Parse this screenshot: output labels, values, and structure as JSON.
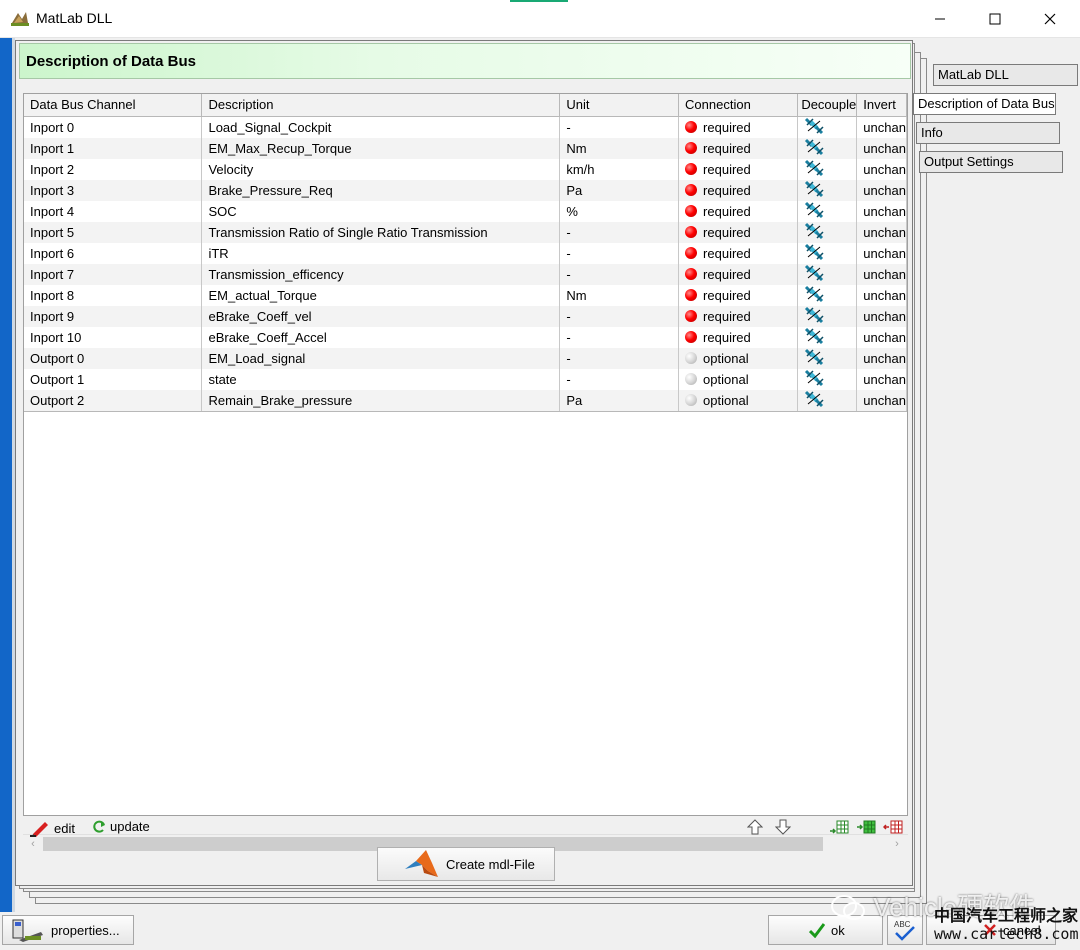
{
  "window": {
    "title": "MatLab DLL"
  },
  "header": {
    "title": "Description of Data Bus"
  },
  "table": {
    "columns": [
      "Data Bus Channel",
      "Description",
      "Unit",
      "Connection",
      "Decouple",
      "Invert"
    ],
    "rows": [
      {
        "channel": "Inport 0",
        "description": "Load_Signal_Cockpit",
        "unit": "-",
        "connection": "required",
        "invert": "unchan"
      },
      {
        "channel": "Inport 1",
        "description": "EM_Max_Recup_Torque",
        "unit": "Nm",
        "connection": "required",
        "invert": "unchan"
      },
      {
        "channel": "Inport 2",
        "description": "Velocity",
        "unit": "km/h",
        "connection": "required",
        "invert": "unchan"
      },
      {
        "channel": "Inport 3",
        "description": "Brake_Pressure_Req",
        "unit": "Pa",
        "connection": "required",
        "invert": "unchan"
      },
      {
        "channel": "Inport 4",
        "description": "SOC",
        "unit": "%",
        "connection": "required",
        "invert": "unchan"
      },
      {
        "channel": "Inport 5",
        "description": "Transmission Ratio of Single Ratio Transmission",
        "unit": "-",
        "connection": "required",
        "invert": "unchan"
      },
      {
        "channel": "Inport 6",
        "description": "iTR",
        "unit": "-",
        "connection": "required",
        "invert": "unchan"
      },
      {
        "channel": "Inport 7",
        "description": "Transmission_efficency",
        "unit": "-",
        "connection": "required",
        "invert": "unchan"
      },
      {
        "channel": "Inport 8",
        "description": "EM_actual_Torque",
        "unit": "Nm",
        "connection": "required",
        "invert": "unchan"
      },
      {
        "channel": "Inport 9",
        "description": "eBrake_Coeff_vel",
        "unit": "-",
        "connection": "required",
        "invert": "unchan"
      },
      {
        "channel": "Inport 10",
        "description": "eBrake_Coeff_Accel",
        "unit": "-",
        "connection": "required",
        "invert": "unchan"
      },
      {
        "channel": "Outport 0",
        "description": "EM_Load_signal",
        "unit": "-",
        "connection": "optional",
        "invert": "unchan"
      },
      {
        "channel": "Outport 1",
        "description": "state",
        "unit": "-",
        "connection": "optional",
        "invert": "unchan"
      },
      {
        "channel": "Outport 2",
        "description": "Remain_Brake_pressure",
        "unit": "Pa",
        "connection": "optional",
        "invert": "unchan"
      }
    ]
  },
  "toolbar": {
    "edit_label": "edit",
    "update_label": "update",
    "create_label": "Create mdl-File"
  },
  "tabs": [
    {
      "label": "MatLab DLL",
      "active": false
    },
    {
      "label": "Description of Data Bus",
      "active": true
    },
    {
      "label": "Info",
      "active": false
    },
    {
      "label": "Output Settings",
      "active": false
    }
  ],
  "bottom": {
    "properties_label": "properties...",
    "ok_label": "ok",
    "cancel_label": "cancel"
  },
  "watermark": {
    "line1": "Vehicle硬软件",
    "line2": "中国汽车工程师之家",
    "line3": "www.cartech8.com"
  },
  "colors": {
    "accent_blue": "#1266c8",
    "header_green": "#ccf5cc",
    "required_red": "#ff0000",
    "optional_grey": "#c8c8c8"
  },
  "icons": {
    "app": "matlab-dll-icon",
    "decouple": "decouple-link-icon",
    "edit": "pencil-icon",
    "update": "refresh-icon",
    "up": "arrow-up-icon",
    "down": "arrow-down-icon"
  }
}
